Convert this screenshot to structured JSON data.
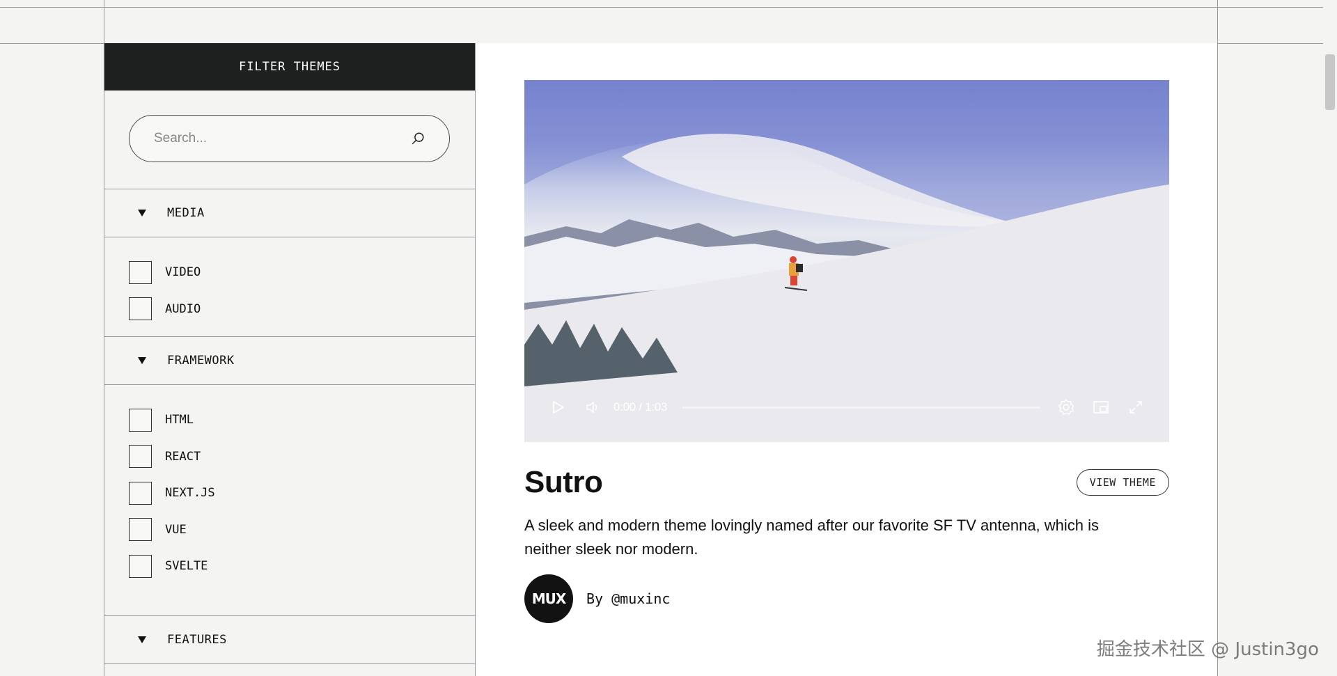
{
  "sidebar": {
    "header": "FILTER THEMES",
    "search_placeholder": "Search...",
    "sections": [
      {
        "label": "MEDIA",
        "options": [
          "VIDEO",
          "AUDIO"
        ]
      },
      {
        "label": "FRAMEWORK",
        "options": [
          "HTML",
          "REACT",
          "NEXT.JS",
          "VUE",
          "SVELTE"
        ]
      },
      {
        "label": "FEATURES"
      }
    ]
  },
  "player": {
    "time": "0:00 / 1:03",
    "progress": 0
  },
  "theme": {
    "title": "Sutro",
    "view_label": "VIEW THEME",
    "description": "A sleek and modern theme lovingly named after our favorite SF TV antenna, which is neither sleek nor modern.",
    "avatar_text": "MUX",
    "author": "By @muxinc"
  },
  "watermark": "掘金技术社区 @ Justin3go",
  "icons": [
    "search-icon",
    "caret-down-icon",
    "play-icon",
    "volume-icon",
    "settings-icon",
    "pip-icon",
    "fullscreen-icon"
  ],
  "colors": {
    "header_bg": "#1e1f1f",
    "page_bg": "#f4f5f2",
    "main_bg": "#ffffff"
  }
}
